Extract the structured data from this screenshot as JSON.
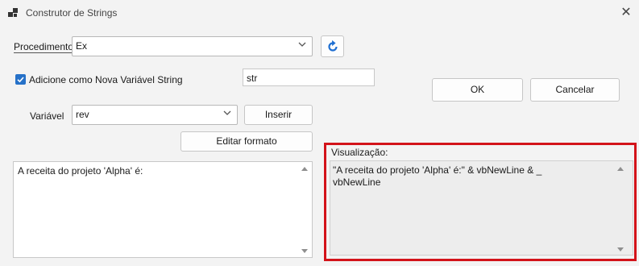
{
  "window": {
    "title": "Construtor de Strings",
    "close_icon": "close-icon"
  },
  "procedimento": {
    "label": "Procedimento",
    "value": "Ex"
  },
  "refresh_icon": "refresh-icon",
  "add_as_new": {
    "checked": true,
    "label": "Adicione como Nova Variável String",
    "name_value": "str"
  },
  "variavel": {
    "label": "Variável",
    "value": "rev"
  },
  "buttons": {
    "inserir": "Inserir",
    "editar_formato": "Editar formato",
    "ok": "OK",
    "cancelar": "Cancelar"
  },
  "editor": {
    "text": "A receita do projeto 'Alpha' é:"
  },
  "preview": {
    "label": "Visualização:",
    "text": "\"A receita do projeto 'Alpha' é:\" & vbNewLine & _\nvbNewLine"
  },
  "colors": {
    "accent": "#2671c8",
    "highlight": "#d3131a"
  }
}
